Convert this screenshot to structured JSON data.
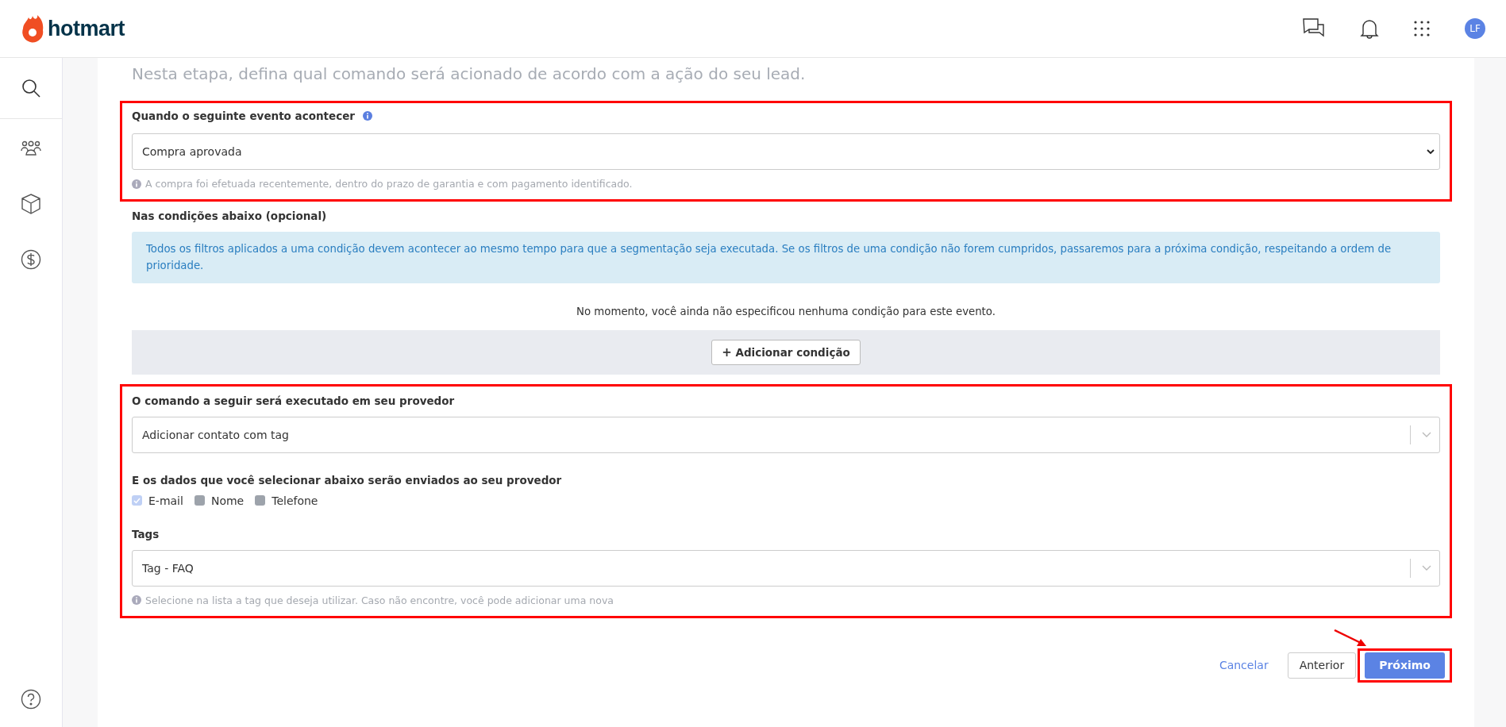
{
  "header": {
    "logo": "hotmart",
    "avatar": "LF"
  },
  "sidebar": {
    "items": [
      {
        "kind": "search"
      },
      {
        "kind": "people"
      },
      {
        "kind": "box"
      },
      {
        "kind": "money"
      }
    ],
    "help": {
      "kind": "help"
    }
  },
  "intro": "Nesta etapa, defina qual comando será acionado de acordo com a ação do seu lead.",
  "event": {
    "label": "Quando o seguinte evento acontecer",
    "value": "Compra aprovada",
    "hint": "A compra foi efetuada recentemente, dentro do prazo de garantia e com pagamento identificado."
  },
  "conditions": {
    "label": "Nas condições abaixo (opcional)",
    "info": "Todos os filtros aplicados a uma condição devem acontecer ao mesmo tempo para que a segmentação seja executada. Se os filtros de uma condição não forem cumpridos, passaremos para a próxima condição, respeitando a ordem de prioridade.",
    "empty": "No momento, você ainda não especificou nenhuma condição para este evento.",
    "add_button": "Adicionar condição",
    "add_icon": "+"
  },
  "command": {
    "label": "O comando a seguir será executado em seu provedor",
    "value": "Adicionar contato com tag"
  },
  "data_fields": {
    "label": "E os dados que você selecionar abaixo serão enviados ao seu provedor",
    "options": [
      {
        "label": "E-mail",
        "checked": true
      },
      {
        "label": "Nome",
        "checked": false
      },
      {
        "label": "Telefone",
        "checked": false
      }
    ]
  },
  "tags": {
    "label": "Tags",
    "value": "Tag - FAQ",
    "hint": "Selecione na lista a tag que deseja utilizar. Caso não encontre, você pode adicionar uma nova"
  },
  "buttons": {
    "cancel": "Cancelar",
    "previous": "Anterior",
    "next": "Próximo"
  }
}
